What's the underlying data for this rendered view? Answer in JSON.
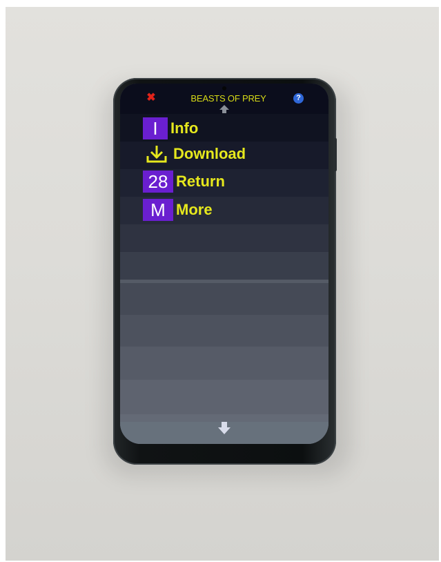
{
  "app": {
    "title": "BEASTS OF PREY"
  },
  "menu": {
    "items": [
      {
        "badge": "I",
        "label": "Info",
        "icon": "info-letter-icon"
      },
      {
        "badge": "",
        "label": "Download",
        "icon": "download-icon"
      },
      {
        "badge": "28",
        "label": "Return",
        "icon": "return-number-icon"
      },
      {
        "badge": "M",
        "label": "More",
        "icon": "more-letter-icon"
      }
    ]
  },
  "controls": {
    "close_icon": "close-icon",
    "help_icon": "help-icon",
    "help_glyph": "?",
    "scroll_up_icon": "arrow-up-icon",
    "scroll_down_icon": "arrow-down-icon"
  },
  "colors": {
    "label": "#e6e81d",
    "title": "#d8db16",
    "badge": "#6a1fd0",
    "close": "#e2231a",
    "help": "#2f67d8",
    "header_bg": "#0b0d1c"
  }
}
